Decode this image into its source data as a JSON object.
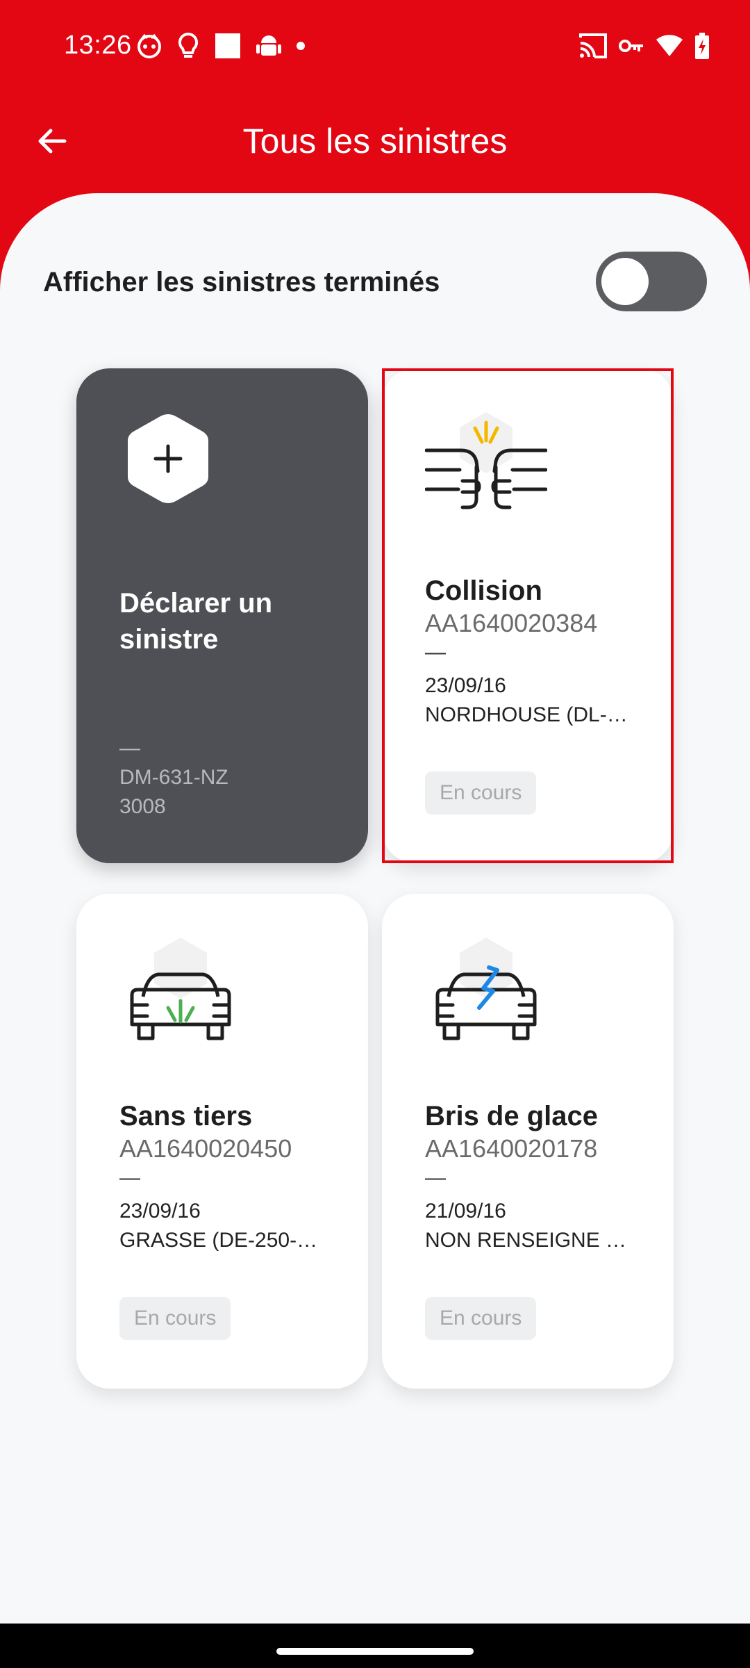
{
  "status_bar": {
    "time": "13:26",
    "left_icons": [
      "face-notification-icon",
      "lightbulb-icon",
      "square-icon",
      "android-icon",
      "dot-icon"
    ],
    "right_icons": [
      "cast-icon",
      "vpn-key-icon",
      "wifi-icon",
      "battery-charging-icon"
    ]
  },
  "app_bar": {
    "title": "Tous les sinistres",
    "back_icon": "arrow-back-icon"
  },
  "filter": {
    "label": "Afficher les sinistres terminés",
    "toggle_on": false
  },
  "declare_card": {
    "icon": "plus-icon",
    "title": "Déclarer un sinistre",
    "dash": "—",
    "plate": "DM-631-NZ",
    "model": "3008"
  },
  "claims": [
    {
      "type": "Collision",
      "number": "AA1640020384",
      "dash": "—",
      "date": "23/09/16",
      "place": "NORDHOUSE (DL-1…",
      "status": "En cours",
      "icon": "collision-icon",
      "accent": "#f5b800"
    },
    {
      "type": "Sans tiers",
      "number": "AA1640020450",
      "dash": "—",
      "date": "23/09/16",
      "place": "GRASSE (DE-250-G…",
      "status": "En cours",
      "icon": "car-front-icon",
      "accent": "#4caf50"
    },
    {
      "type": "Bris de glace",
      "number": "AA1640020178",
      "dash": "—",
      "date": "21/09/16",
      "place": "NON RENSEIGNE (…",
      "status": "En cours",
      "icon": "broken-windshield-icon",
      "accent": "#1e88e5"
    }
  ],
  "colors": {
    "brand_red": "#e30613",
    "background": "#f7f8fa",
    "declare_card": "#4e5055",
    "status_badge_bg": "#eeeff1"
  }
}
